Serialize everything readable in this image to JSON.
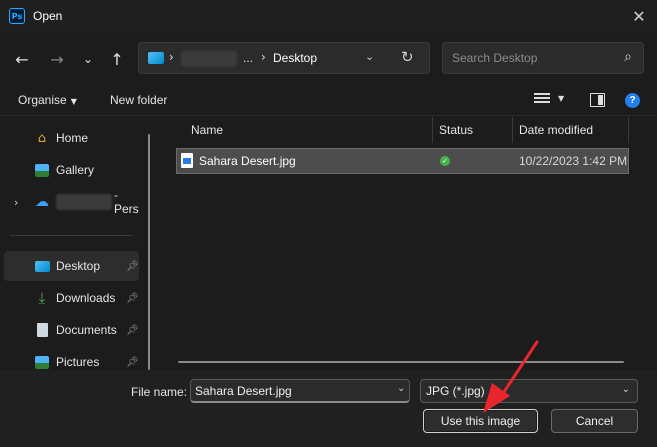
{
  "window": {
    "app_icon_text": "Ps",
    "title": "Open"
  },
  "nav": {
    "back_icon": "←",
    "forward_icon": "→",
    "recent_icon": "⌄",
    "up_icon": "↑"
  },
  "address": {
    "ellipsis": "...",
    "current_folder": "Desktop",
    "chevron": "›"
  },
  "search": {
    "placeholder": "Search Desktop"
  },
  "toolbar": {
    "organise_label": "Organise",
    "new_folder_label": "New folder",
    "help_label": "?"
  },
  "sidebar": {
    "items": [
      {
        "label": "Home",
        "icon": "home-icon"
      },
      {
        "label": "Gallery",
        "icon": "gallery-icon"
      },
      {
        "label": "- Pers",
        "icon": "onedrive-icon"
      },
      {
        "label": "Desktop",
        "icon": "desktop-icon",
        "pinned": true,
        "selected": true
      },
      {
        "label": "Downloads",
        "icon": "download-icon",
        "pinned": true
      },
      {
        "label": "Documents",
        "icon": "documents-icon",
        "pinned": true
      },
      {
        "label": "Pictures",
        "icon": "pictures-icon",
        "pinned": true
      }
    ]
  },
  "files": {
    "columns": {
      "name": "Name",
      "status": "Status",
      "date": "Date modified"
    },
    "rows": [
      {
        "name": "Sahara Desert.jpg",
        "status": "synced",
        "date": "10/22/2023 1:42 PM",
        "selected": true
      }
    ]
  },
  "footer": {
    "file_name_label": "File name:",
    "file_name_value": "Sahara Desert.jpg",
    "file_type_value": "JPG (*.jpg)",
    "open_button": "Use this image",
    "cancel_button": "Cancel"
  },
  "colors": {
    "background": "#1c1c1c",
    "selected_row": "#4d4d4d",
    "accent": "#2680eb",
    "annotation_arrow": "#e8262b"
  }
}
